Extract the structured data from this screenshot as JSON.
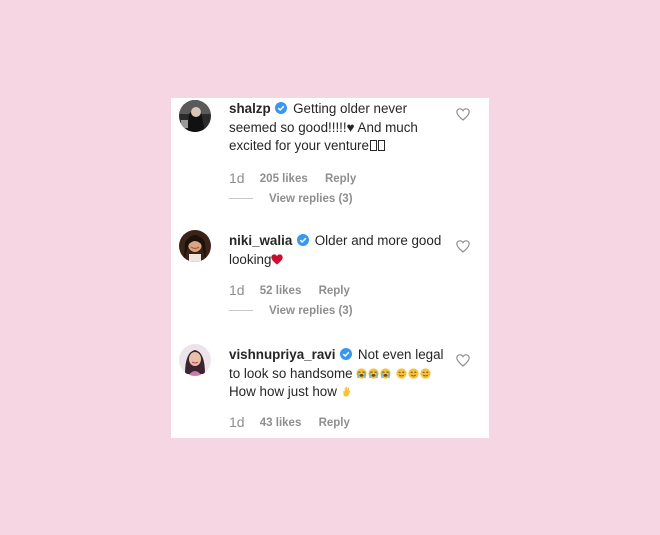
{
  "comments": [
    {
      "username": "shalzp",
      "text_1": "Getting older never seemed so good!!!!!",
      "heart": "♥",
      "text_2": " And much excited for your venture",
      "time": "1d",
      "likes": "205 likes",
      "reply": "Reply",
      "view_replies": "View replies (3)"
    },
    {
      "username": "niki_walia",
      "text_1": "Older and more good looking",
      "time": "1d",
      "likes": "52 likes",
      "reply": "Reply",
      "view_replies": "View replies (3)"
    },
    {
      "username": "vishnupriya_ravi",
      "text_1": "Not even legal to look so handsome ",
      "text_2": " How how just how ",
      "time": "1d",
      "likes": "43 likes",
      "reply": "Reply"
    }
  ],
  "colors": {
    "background": "#f7d6e4",
    "card": "#ffffff",
    "text": "#262626",
    "muted": "#8e8e8e",
    "verified": "#3897f0",
    "heart_red": "#c8102e"
  },
  "icons": {
    "verified": "verified-badge-icon",
    "like": "heart-outline-icon",
    "emoji_cry": "loudly-crying-face-icon",
    "emoji_smile": "smiling-face-icon",
    "emoji_hand": "raised-hand-icon"
  }
}
